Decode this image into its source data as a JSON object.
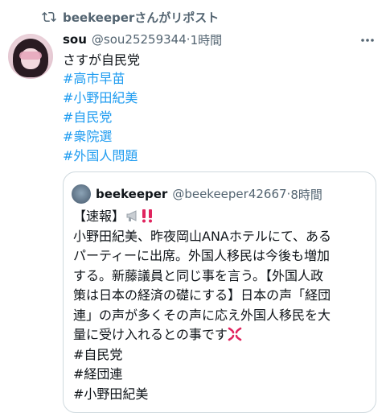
{
  "repost": {
    "icon": "repost-icon",
    "text": "beekeeperさんがリポスト"
  },
  "post": {
    "author_name": "sou",
    "author_handle": "@sou25259344",
    "separator": "·",
    "time": "1時間",
    "text": "さすが自民党",
    "hashtags": [
      "#高市早苗",
      "#小野田紀美",
      "#自民党",
      "#衆院選",
      "#外国人問題"
    ]
  },
  "quote": {
    "author_name": "beekeeper",
    "author_handle": "@beekeeper42667",
    "separator": "·",
    "time": "8時間",
    "lines": [
      "【速報】",
      "小野田紀美、昨夜岡山ANAホテルにて、ある",
      "パーティーに出席。外国人移民は今後も増加",
      "する。新藤議員と同じ事を言う。【外国人政",
      "策は日本の経済の礎にする】日本の声「経団",
      "連」の声が多くその声に応え外国人移民を大",
      "量に受け入れるとの事です",
      "#自民党",
      "#経団連",
      "#小野田紀美"
    ]
  },
  "colors": {
    "link": "#1d9bf0",
    "secondary": "#536471",
    "text": "#0f1419",
    "border": "#cfd9de"
  }
}
